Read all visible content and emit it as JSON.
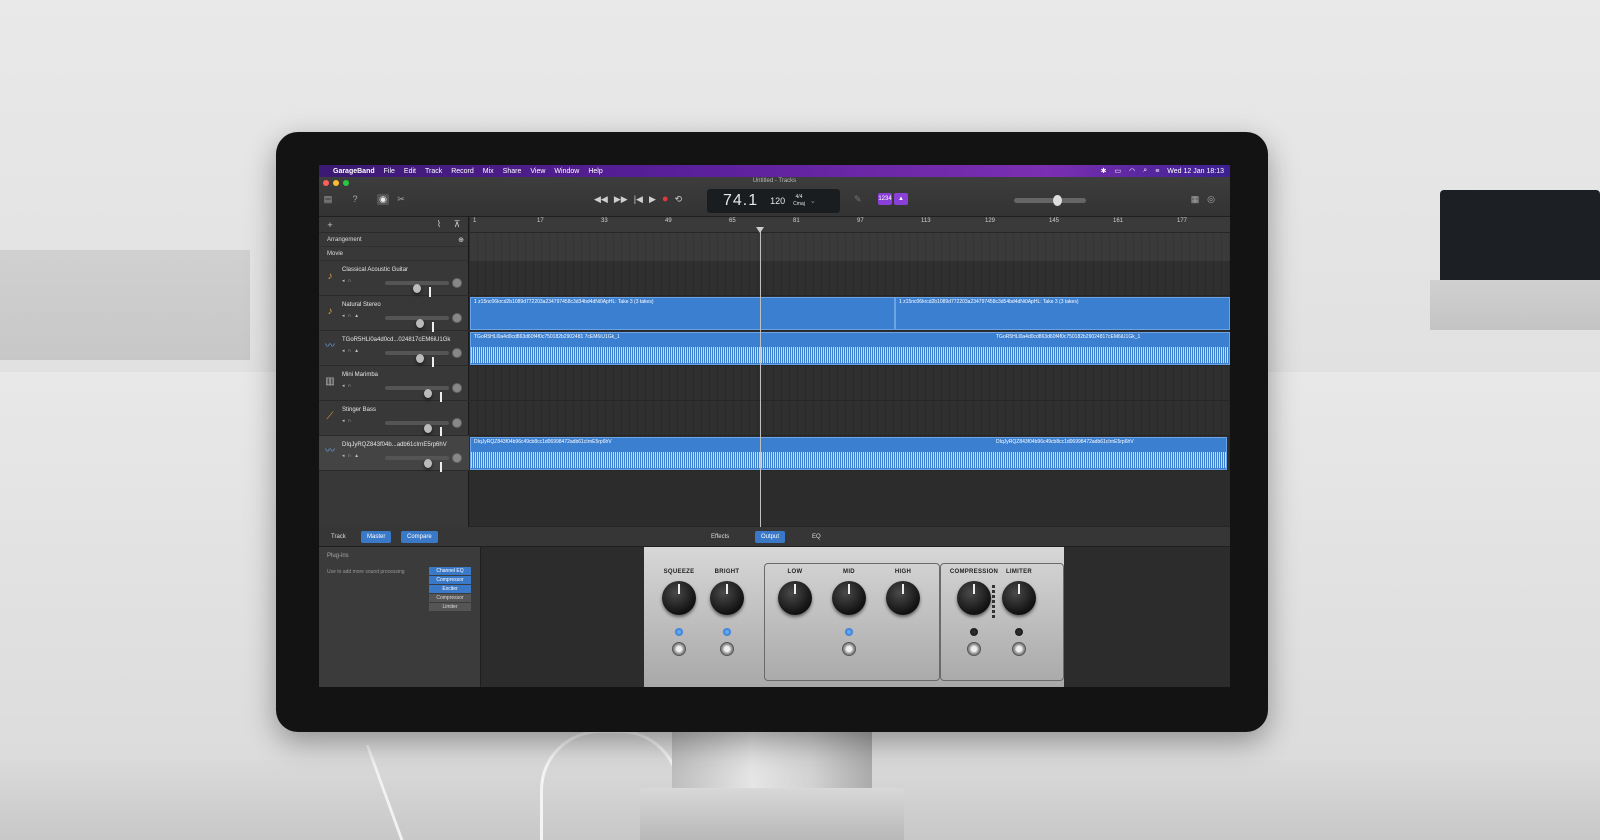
{
  "menubar": {
    "app_name": "GarageBand",
    "menus": [
      "File",
      "Edit",
      "Track",
      "Record",
      "Mix",
      "Share",
      "View",
      "Window",
      "Help"
    ],
    "clock": "Wed 12 Jan  18:13"
  },
  "window": {
    "title": "Untitled - Tracks"
  },
  "lcd": {
    "position": "74.1",
    "tempo": "120",
    "signature": "4/4",
    "key": "Cmaj"
  },
  "count_in": {
    "badge": "1234"
  },
  "header": {
    "arrangement": "Arrangement",
    "movie": "Movie"
  },
  "ruler": {
    "ticks": [
      "1",
      "17",
      "33",
      "49",
      "65",
      "81",
      "97",
      "113",
      "129",
      "145",
      "161",
      "177"
    ]
  },
  "tracks": [
    {
      "name": "Classical Acoustic Guitar",
      "icon": "guitar-icon",
      "level": 0.5
    },
    {
      "name": "Natural Stereo",
      "icon": "guitar-icon",
      "level": 0.55
    },
    {
      "name": "TGoR5HLl0a4d0cd...024817cEM6iU1Gk",
      "icon": "waveform-icon",
      "level": 0.55
    },
    {
      "name": "Mini Marimba",
      "icon": "marimba-icon",
      "level": 0.7
    },
    {
      "name": "Stinger Bass",
      "icon": "bass-icon",
      "level": 0.7
    },
    {
      "name": "DIqJyRQZ843f04b...adb61cIrnE5rp6hV",
      "icon": "waveform-icon",
      "level": 0.7
    }
  ],
  "regions": {
    "natural_a": "1  z15nc06krcd2b1089d772203a234797458c3d34bd4dNi0ApHL: Take 3 (3 takes)",
    "natural_b": "1  z15nc06krcd2b1089d772203a234797458c3d54bd4dNi0ApHL: Take 3 (3 takes)",
    "tgor_a": "TGoR5HLl0a4d0cd863d60f4f0c750182b2902481 7cEM6iU1Gk_1",
    "tgor_b": "TGoR5HLl0a4d0cd863d60f4f0c750182b29024817cEM6iU1Gk_1",
    "diq_a": "DIqJyRQZ843f04b96c49cb8cc1d06998472adb61cIrnE5rp6hV",
    "diq_b": "DIqJyRQZ843f04b96c49cb8cc1d06998472adb61cIrnE5rp6hV"
  },
  "smart_tabs": {
    "track": "Track",
    "master": "Master",
    "compare": "Compare",
    "effects": "Effects",
    "output": "Output",
    "eq": "EQ"
  },
  "plugins": {
    "title": "Plug-ins",
    "hint": "Use to add more sound processing",
    "list": [
      "Channel EQ",
      "Compressor",
      "Exciter",
      "Compressor",
      "Limiter"
    ]
  },
  "amp": {
    "knobs": {
      "squeeze": "SQUEEZE",
      "bright": "BRIGHT",
      "low": "LOW",
      "mid": "MID",
      "high": "HIGH",
      "compression": "COMPRESSION",
      "limiter": "LIMITER"
    }
  },
  "colors": {
    "accent": "#3a78c8",
    "menubar": "#5a1f9b",
    "region": "#3b7fd0",
    "record": "#e23a3a"
  }
}
